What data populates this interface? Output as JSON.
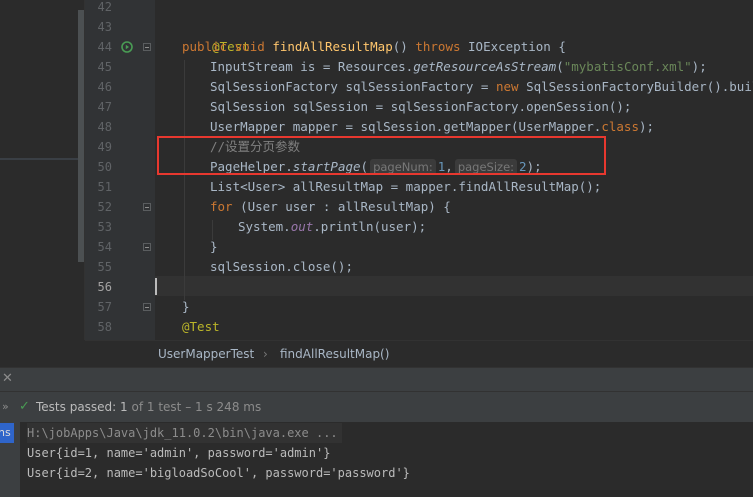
{
  "editor": {
    "line_numbers": [
      "42",
      "43",
      "44",
      "45",
      "46",
      "47",
      "48",
      "49",
      "50",
      "51",
      "52",
      "53",
      "54",
      "55",
      "56",
      "57",
      "58"
    ],
    "current_line": "56",
    "code": {
      "l43_annotation": "@Test",
      "l44_public": "public",
      "l44_void": "void",
      "l44_method": "findAllResultMap",
      "l44_parens": "()",
      "l44_throws": "throws",
      "l44_rest": "IOException {",
      "l45_a": "InputStream is = Resources.",
      "l45_method": "getResourceAsStream",
      "l45_b": "(",
      "l45_string": "\"mybatisConf.xml\"",
      "l45_c": ");",
      "l46_a": "SqlSessionFactory sqlSessionFactory = ",
      "l46_new": "new",
      "l46_b": " SqlSessionFactoryBuilder().build(is);",
      "l47": "SqlSession sqlSession = sqlSessionFactory.openSession();",
      "l48_a": "UserMapper mapper = sqlSession.getMapper(UserMapper.",
      "l48_class": "class",
      "l48_b": ");",
      "l49_comment": "//设置分页参数",
      "l50_a": "PageHelper.",
      "l50_method": "startPage",
      "l50_b": "(",
      "l50_hint1": "pageNum:",
      "l50_num1": "1",
      "l50_comma": ",",
      "l50_hint2": "pageSize:",
      "l50_num2": "2",
      "l50_c": ");",
      "l51": "List<User> allResultMap = mapper.findAllResultMap();",
      "l52_for": "for",
      "l52_rest": " (User user : allResultMap) {",
      "l53_a": "System.",
      "l53_out": "out",
      "l53_b": ".println(user);",
      "l54": "}",
      "l55": "sqlSession.close();",
      "l57": "}",
      "l58_annotation": "@Test"
    }
  },
  "breadcrumb": {
    "class_name": "UserMapperTest",
    "separator": "›",
    "method_name": "findAllResultMap()"
  },
  "tool_window": {
    "close_glyph": "✕",
    "expand_glyph": "»",
    "check_glyph": "✓",
    "status_label": "Tests passed:",
    "passed_count": "1",
    "of_total": "of 1 test",
    "duration": "– 1 s 248 ms",
    "side_tab": "ns"
  },
  "console": {
    "lines": [
      "H:\\jobApps\\Java\\jdk_11.0.2\\bin\\java.exe ...",
      "User{id=1, name='admin', password='admin'}",
      "User{id=2, name='bigloadSoCool', password='password'}"
    ]
  },
  "colors": {
    "highlight_box": "#e8382f",
    "pass_green": "#499c54",
    "selected_tab": "#2f65ca"
  }
}
